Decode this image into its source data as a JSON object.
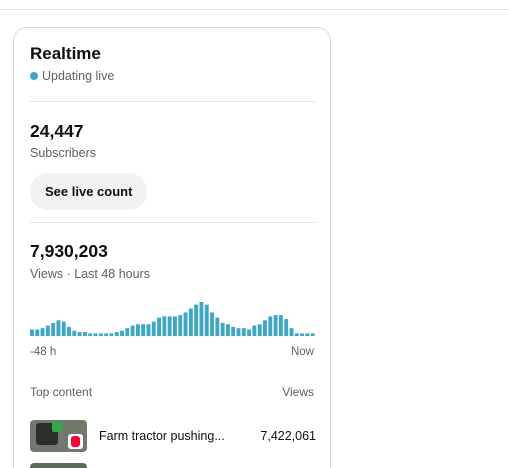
{
  "card": {
    "title": "Realtime",
    "live_label": "Updating live",
    "subscribers": {
      "value": "24,447",
      "label": "Subscribers",
      "button": "See live count"
    },
    "views": {
      "value": "7,930,203",
      "label": "Views · Last 48 hours"
    },
    "chart_axis": {
      "start": "-48 h",
      "end": "Now"
    },
    "top_content": {
      "heading": "Top content",
      "views_heading": "Views",
      "items": [
        {
          "title": "Farm tractor pushing...",
          "views": "7,422,061"
        }
      ]
    }
  },
  "chart_data": {
    "type": "bar",
    "title": "",
    "xlabel": "",
    "ylabel": "",
    "x_range": [
      "-48 h",
      "Now"
    ],
    "values": [
      5,
      5,
      6,
      8,
      10,
      12,
      11,
      7,
      4,
      3,
      3,
      2,
      2,
      2,
      2,
      2,
      3,
      4,
      6,
      8,
      9,
      9,
      9,
      11,
      14,
      15,
      15,
      15,
      16,
      18,
      21,
      24,
      26,
      24,
      18,
      14,
      10,
      9,
      7,
      6,
      6,
      5,
      8,
      9,
      12,
      15,
      16,
      16,
      13,
      6,
      2,
      2,
      2,
      2
    ],
    "color": "#3ea6c7",
    "grid": false
  },
  "colors": {
    "accent": "#3ea6c7",
    "text_secondary": "#606060",
    "badge": "#ff0033"
  }
}
